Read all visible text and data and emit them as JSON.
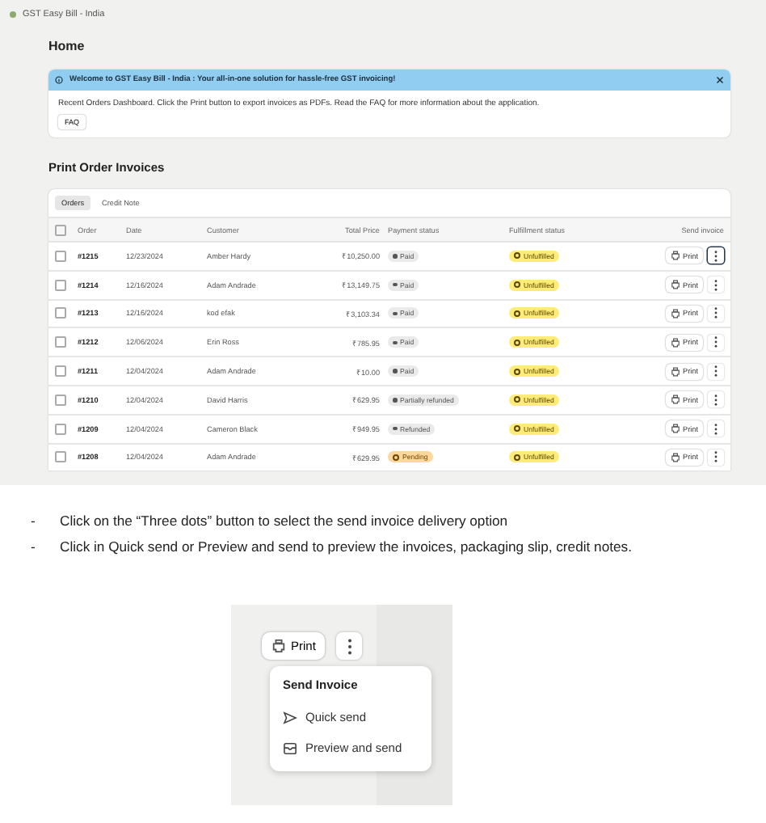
{
  "app": {
    "title": "GST Easy Bill - India",
    "page_title": "Home",
    "banner": {
      "title": "Welcome to GST Easy Bill - India : Your all-in-one solution for hassle-free GST invoicing!",
      "text": "Recent Orders Dashboard. Click the Print button to export invoices as PDFs. Read the FAQ for more information about the application.",
      "button": "FAQ"
    },
    "section_title": "Print Order Invoices",
    "tabs": [
      {
        "label": "Orders",
        "selected": true
      },
      {
        "label": "Credit Note",
        "selected": false
      }
    ],
    "table": {
      "select_all_checked": false,
      "columns": [
        "Order",
        "Date",
        "Customer",
        "Total Price",
        "Payment status",
        "Fulfillment status",
        "Send invoice"
      ],
      "rows": [
        {
          "checked": false,
          "order": "#1215",
          "date": "12/23/2024",
          "customer": "Amber Hardy",
          "total": "₹10,250.00",
          "payment": {
            "label": "Paid",
            "kind": "paid"
          },
          "fulfillment": {
            "label": "Unfulfilled",
            "kind": "unfulfilled"
          },
          "print": "Print",
          "menu_selected": true
        },
        {
          "checked": false,
          "order": "#1214",
          "date": "12/16/2024",
          "customer": "Adam Andrade",
          "total": "₹13,149.75",
          "payment": {
            "label": "Paid",
            "kind": "paid"
          },
          "fulfillment": {
            "label": "Unfulfilled",
            "kind": "unfulfilled"
          },
          "print": "Print",
          "menu_selected": false
        },
        {
          "checked": false,
          "order": "#1213",
          "date": "12/16/2024",
          "customer": "kod efak",
          "total": "₹3,103.34",
          "payment": {
            "label": "Paid",
            "kind": "paid"
          },
          "fulfillment": {
            "label": "Unfulfilled",
            "kind": "unfulfilled"
          },
          "print": "Print",
          "menu_selected": false
        },
        {
          "checked": false,
          "order": "#1212",
          "date": "12/06/2024",
          "customer": "Erin Ross",
          "total": "₹785.95",
          "payment": {
            "label": "Paid",
            "kind": "paid"
          },
          "fulfillment": {
            "label": "Unfulfilled",
            "kind": "unfulfilled"
          },
          "print": "Print",
          "menu_selected": false
        },
        {
          "checked": false,
          "order": "#1211",
          "date": "12/04/2024",
          "customer": "Adam Andrade",
          "total": "₹10.00",
          "payment": {
            "label": "Paid",
            "kind": "paid"
          },
          "fulfillment": {
            "label": "Unfulfilled",
            "kind": "unfulfilled"
          },
          "print": "Print",
          "menu_selected": false
        },
        {
          "checked": false,
          "order": "#1210",
          "date": "12/04/2024",
          "customer": "David Harris",
          "total": "₹629.95",
          "payment": {
            "label": "Partially refunded",
            "kind": "refunded"
          },
          "fulfillment": {
            "label": "Unfulfilled",
            "kind": "unfulfilled"
          },
          "print": "Print",
          "menu_selected": false
        },
        {
          "checked": false,
          "order": "#1209",
          "date": "12/04/2024",
          "customer": "Cameron Black",
          "total": "₹949.95",
          "payment": {
            "label": "Refunded",
            "kind": "refunded"
          },
          "fulfillment": {
            "label": "Unfulfilled",
            "kind": "unfulfilled"
          },
          "print": "Print",
          "menu_selected": false
        },
        {
          "checked": false,
          "order": "#1208",
          "date": "12/04/2024",
          "customer": "Adam Andrade",
          "total": "₹629.95",
          "payment": {
            "label": "Pending",
            "kind": "pending"
          },
          "fulfillment": {
            "label": "Unfulfilled",
            "kind": "unfulfilled"
          },
          "print": "Print",
          "menu_selected": false
        }
      ]
    }
  },
  "steps": [
    {
      "bullet": "-",
      "text": "Click on the “Three dots” button to select the send invoice delivery option"
    },
    {
      "bullet": "-",
      "text": "Click in Quick send or Preview and send to preview the invoices, packaging slip, credit notes."
    }
  ],
  "popup_shot": {
    "print": "Print",
    "menu": {
      "title": "Send Invoice",
      "items": [
        {
          "label": "Quick send",
          "kind": "send"
        },
        {
          "label": "Preview and send",
          "kind": "mail"
        }
      ]
    }
  }
}
